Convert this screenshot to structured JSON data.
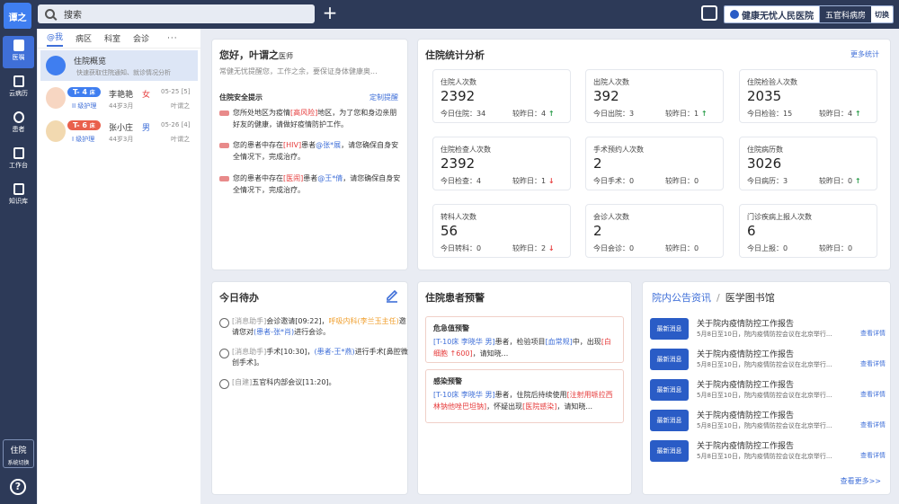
{
  "app": {
    "logo_text": "谭之",
    "search_placeholder": "搜索",
    "hospital_name": "健康无忧人民医院",
    "ward": "五官科病房",
    "switch_label": "切换"
  },
  "nav": {
    "items": [
      {
        "label": "医嘱",
        "active": true
      },
      {
        "label": "云病历",
        "active": false
      },
      {
        "label": "患者",
        "active": false
      },
      {
        "label": "工作台",
        "active": false
      },
      {
        "label": "知识库",
        "active": false
      }
    ],
    "system": {
      "label": "住院",
      "sub": "系统切换"
    },
    "help": "?"
  },
  "patients": {
    "tabs": [
      {
        "label": "@我",
        "active": true
      },
      {
        "label": "病区",
        "active": false
      },
      {
        "label": "科室",
        "active": false
      },
      {
        "label": "会诊",
        "active": false
      }
    ],
    "more": "···",
    "overview": {
      "title": "住院概览",
      "sub": "快速获取住院通知、就诊情况分析"
    },
    "list": [
      {
        "bed": "T- 4",
        "bed_unit": "床",
        "care": "II 级护理",
        "name": "李艳艳",
        "sex": "女",
        "age": "44岁3月",
        "date": "05-25 [5]",
        "doctor": "叶谓之"
      },
      {
        "bed": "T- 6",
        "bed_unit": "床",
        "care": "I 级护理",
        "name": "张小庄",
        "sex": "男",
        "age": "44岁3月",
        "date": "05-26 [4]",
        "doctor": "叶谓之"
      }
    ]
  },
  "greeting": {
    "title": "您好，叶谓之",
    "title_suffix": "医师",
    "sub": "常健无忧提醒您，工作之余，要保证身体健康奥...",
    "safety_title": "住院安全提示",
    "custom_label": "定制提醒",
    "alerts": [
      {
        "p1": "您所处地区为疫情",
        "h1": "[高风险]",
        "p2": "地区，为了您和身边亲朋好友的健康，请做好疫情防护工作。"
      },
      {
        "p1": "您的患者中存在",
        "h1": "[HIV]",
        "p2": "患者",
        "h2": "@张*展",
        "p3": "，请您确保自身安全情况下，完成治疗。"
      },
      {
        "p1": "您的患者中存在",
        "h1": "[医闹]",
        "p2": "患者",
        "h2": "@王*倩",
        "p3": "，请您确保自身安全情况下，完成治疗。"
      }
    ]
  },
  "stats": {
    "title": "住院统计分析",
    "more": "更多统计",
    "items": [
      {
        "label": "住院人次数",
        "value": "2392",
        "today_label": "今日住院：",
        "today": "34",
        "cmp_label": "较昨日：",
        "cmp": "4",
        "trend": "up"
      },
      {
        "label": "出院人次数",
        "value": "392",
        "today_label": "今日出院：",
        "today": "3",
        "cmp_label": "较昨日：",
        "cmp": "1",
        "trend": "up"
      },
      {
        "label": "住院检验人次数",
        "value": "2035",
        "today_label": "今日检验：",
        "today": "15",
        "cmp_label": "较昨日：",
        "cmp": "4",
        "trend": "up"
      },
      {
        "label": "住院检查人次数",
        "value": "2392",
        "today_label": "今日检查：",
        "today": "4",
        "cmp_label": "较昨日：",
        "cmp": "1",
        "trend": "down"
      },
      {
        "label": "手术预约人次数",
        "value": "2",
        "today_label": "今日手术：",
        "today": "0",
        "cmp_label": "较昨日：",
        "cmp": "0",
        "trend": ""
      },
      {
        "label": "住院病历数",
        "value": "3026",
        "today_label": "今日病历：",
        "today": "3",
        "cmp_label": "较昨日：",
        "cmp": "0",
        "trend": "up"
      },
      {
        "label": "转科人次数",
        "value": "56",
        "today_label": "今日转科：",
        "today": "0",
        "cmp_label": "较昨日：",
        "cmp": "2",
        "trend": "down"
      },
      {
        "label": "会诊人次数",
        "value": "2",
        "today_label": "今日会诊：",
        "today": "0",
        "cmp_label": "较昨日：",
        "cmp": "0",
        "trend": ""
      },
      {
        "label": "门诊疾病上报人次数",
        "value": "6",
        "today_label": "今日上报：",
        "today": "0",
        "cmp_label": "较昨日：",
        "cmp": "0",
        "trend": ""
      }
    ]
  },
  "todo": {
    "title": "今日待办",
    "items": [
      {
        "tag": "[消息助手]",
        "t1": "会诊邀请[09:22]，",
        "o1": "呼吸内科(李兰玉主任)",
        "t2": "邀请您对",
        "b1": "(患者-张*肖)",
        "t3": "进行会诊。"
      },
      {
        "tag": "[消息助手]",
        "t1": "手术[10:30]，",
        "b1": "(患者-王*燕)",
        "t2": "进行手术[鼻腔微创手术]。"
      },
      {
        "tag": "[自建]",
        "t1": "五官科内部会议[11:20]。"
      }
    ]
  },
  "warning": {
    "title": "住院患者预警",
    "items": [
      {
        "title": "危急值预警",
        "bed": "[T-10床",
        "name": "李晓华",
        "sex": "男]",
        "p1": "患者，检验项目",
        "proj": "[血常规]",
        "p2": "中，出现",
        "val": "[白细胞 ↑600]",
        "p3": "，请知晓..."
      },
      {
        "title": "感染预警",
        "bed": "[T-10床",
        "name": "李晓华",
        "sex": "男]",
        "p1": "患者，住院后持续使用",
        "proj": "[注射用哌拉西林钠他唑巴坦钠]",
        "p2": "，怀疑出现",
        "val": "[医院感染]",
        "p3": "，请知晓..."
      }
    ]
  },
  "news": {
    "tab_active": "院内公告资讯",
    "tab_sep": "/",
    "tab_other": "医学图书馆",
    "badge": "最新消息",
    "view": "查看详情",
    "items": [
      {
        "title": "关于院内疫情防控工作报告",
        "desc": "5月8日至10日，院内疫情防控会议在北京举行..."
      },
      {
        "title": "关于院内疫情防控工作报告",
        "desc": "5月8日至10日，院内疫情防控会议在北京举行..."
      },
      {
        "title": "关于院内疫情防控工作报告",
        "desc": "5月8日至10日，院内疫情防控会议在北京举行..."
      },
      {
        "title": "关于院内疫情防控工作报告",
        "desc": "5月8日至10日，院内疫情防控会议在北京举行..."
      },
      {
        "title": "关于院内疫情防控工作报告",
        "desc": "5月8日至10日，院内疫情防控会议在北京举行..."
      }
    ],
    "more": "查看更多>>"
  }
}
